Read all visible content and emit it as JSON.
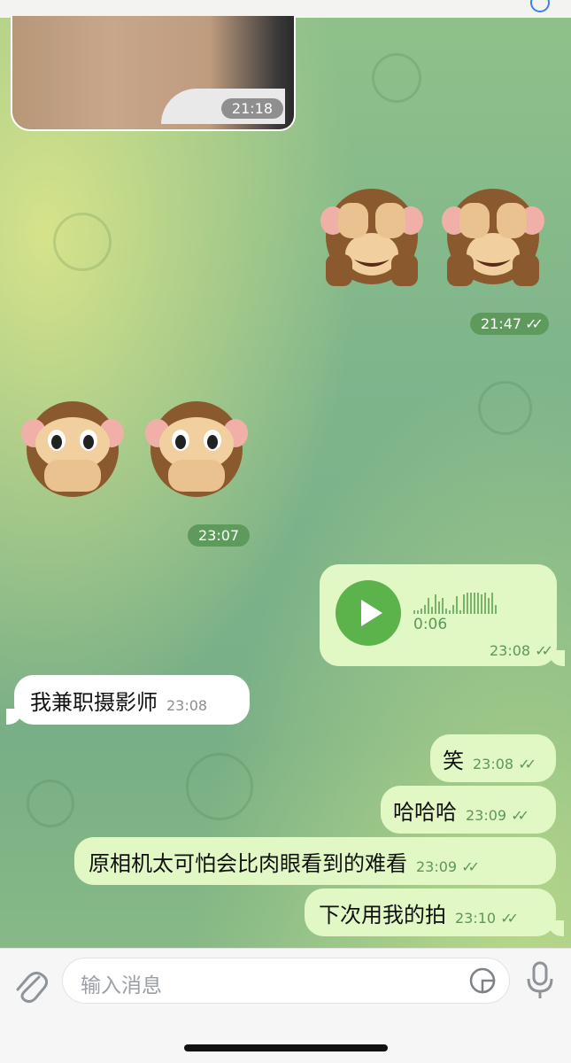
{
  "photo_message": {
    "time": "21:18"
  },
  "sticker_sent": {
    "emoji": [
      "🙈",
      "🙈"
    ],
    "time": "21:47",
    "status": "read"
  },
  "sticker_received": {
    "emoji": [
      "🙊",
      "🙊"
    ],
    "time": "23:07"
  },
  "voice_message": {
    "duration": "0:06",
    "time": "23:08",
    "status": "read"
  },
  "messages": [
    {
      "direction": "incoming",
      "text": "我兼职摄影师",
      "time": "23:08"
    },
    {
      "direction": "outgoing",
      "text": "笑",
      "time": "23:08",
      "status": "read"
    },
    {
      "direction": "outgoing",
      "text": "哈哈哈",
      "time": "23:09",
      "status": "read"
    },
    {
      "direction": "outgoing",
      "text": "原相机太可怕会比肉眼看到的难看",
      "time": "23:09",
      "status": "read"
    },
    {
      "direction": "outgoing",
      "text": "下次用我的拍",
      "time": "23:10",
      "status": "read"
    }
  ],
  "composer": {
    "placeholder": "输入消息"
  },
  "icons": {
    "attach": "paperclip-icon",
    "sticker": "sticker-icon",
    "mic": "microphone-icon",
    "read": "double-check-icon",
    "play": "play-icon"
  },
  "colors": {
    "outgoing_bubble": "#e1f7c4",
    "incoming_bubble": "#ffffff",
    "accent_green": "#5cb24b",
    "time_green": "#5c9a53"
  }
}
